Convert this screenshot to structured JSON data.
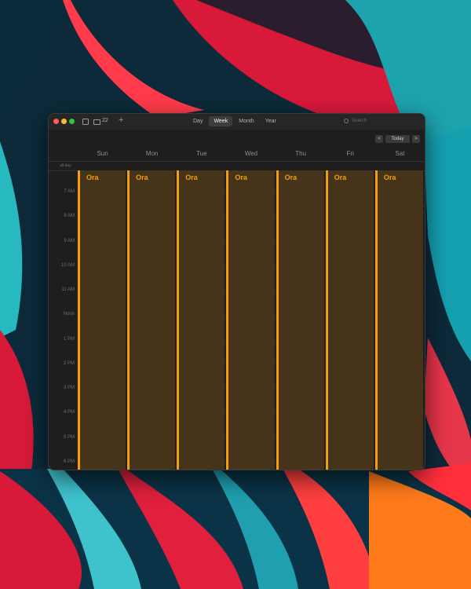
{
  "toolbar": {
    "inbox_count": "22",
    "add_label": "+",
    "views": [
      "Day",
      "Week",
      "Month",
      "Year"
    ],
    "active_view": "Week",
    "search_placeholder": "Search",
    "prev_label": "<",
    "today_label": "Today",
    "next_label": ">"
  },
  "week": {
    "days": [
      "Sun",
      "Mon",
      "Tue",
      "Wed",
      "Thu",
      "Fri",
      "Sat"
    ],
    "all_day_label": "all-day",
    "time_labels": [
      "7 AM",
      "8 AM",
      "9 AM",
      "10 AM",
      "11 AM",
      "Noon",
      "1 PM",
      "2 PM",
      "3 PM",
      "4 PM",
      "5 PM",
      "6 PM"
    ]
  },
  "events": [
    {
      "title": "Ora"
    },
    {
      "title": "Ora"
    },
    {
      "title": "Ora"
    },
    {
      "title": "Ora"
    },
    {
      "title": "Ora"
    },
    {
      "title": "Ora"
    },
    {
      "title": "Ora"
    }
  ],
  "colors": {
    "event_accent": "#f59e0b",
    "event_fill": "#45331a",
    "window_bg": "#1e1e1e"
  }
}
